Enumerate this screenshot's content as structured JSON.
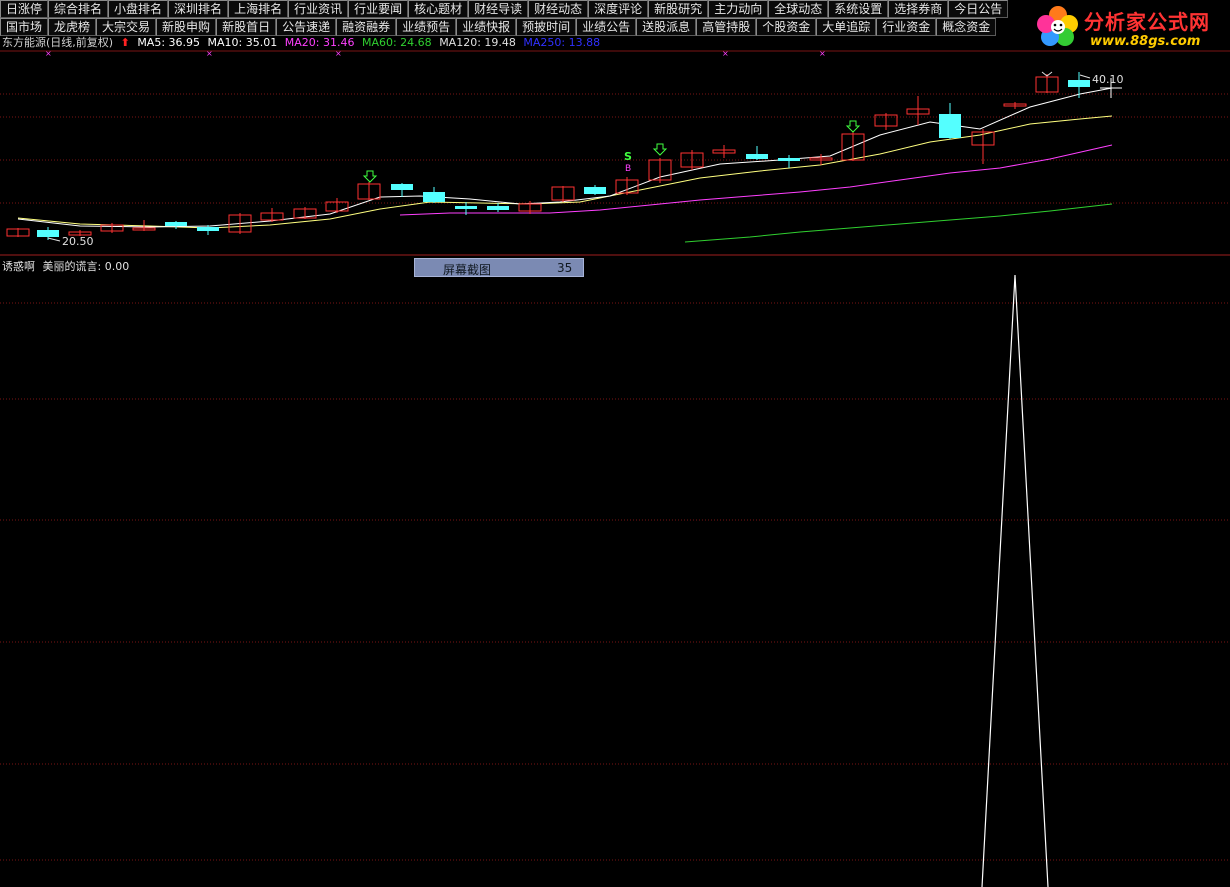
{
  "menu_row1": [
    "日涨停",
    "综合排名",
    "小盘排名",
    "深圳排名",
    "上海排名",
    "行业资讯",
    "行业要闻",
    "核心题材",
    "财经导读",
    "财经动态",
    "深度评论",
    "新股研究",
    "主力动向",
    "全球动态",
    "系统设置",
    "选择券商",
    "今日公告"
  ],
  "menu_row2": [
    "国市场",
    "龙虎榜",
    "大宗交易",
    "新股申购",
    "新股首日",
    "公告速递",
    "融资融券",
    "业绩预告",
    "业绩快报",
    "预披时间",
    "业绩公告",
    "送股派息",
    "高管持股",
    "个股资金",
    "大单追踪",
    "行业资金",
    "概念资金"
  ],
  "logo": {
    "title": "分析家公式网",
    "url": "www.88gs.com"
  },
  "header": {
    "stock_name": "东方能源(日线,前复权)",
    "up_arrow": "⬆",
    "ma5": "MA5: 36.95",
    "ma10": "MA10: 35.01",
    "ma20": "MA20: 31.46",
    "ma60": "MA60: 24.68",
    "ma120": "MA120: 19.48",
    "ma250": "MA250: 13.88"
  },
  "colors": {
    "ma5": "#ffffff",
    "ma10": "#ffff80",
    "ma20": "#ff40ff",
    "ma60": "#30d030",
    "ma120": "#e0e0e0",
    "ma250": "#2020ff",
    "up_candle": "#ff3232",
    "down_candle": "#54ffff",
    "grid": "#7a1515",
    "signal_arrow": "#40ff40",
    "x_marker": "#ff40ff",
    "indicator_line": "#ffffff"
  },
  "price_labels": {
    "low": "20.50",
    "high": "40.10"
  },
  "signal": {
    "s_label": "S",
    "b_label": "B"
  },
  "indicator": {
    "name": "诱惑啊",
    "line_label": "美丽的谎言: 0.00"
  },
  "screenshot_button": {
    "label": "屏幕截图",
    "value": "35"
  }
}
